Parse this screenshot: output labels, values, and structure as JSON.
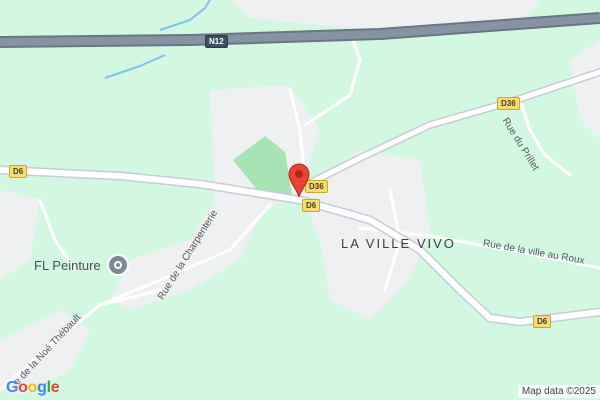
{
  "map": {
    "locality": "LA VILLE VIVO",
    "roads": {
      "charpenterie": "Rue de la Charpenterie",
      "noe_thebault": "e de la Noé Thébault",
      "ville_au_roux": "Rue de la ville au Roux",
      "prillet": "Rue du Prillet"
    },
    "shields": {
      "n12": "N12",
      "d6_left": "D6",
      "d6_center": "D6",
      "d6_right": "D6",
      "d36_top": "D36",
      "d36_center": "D36"
    },
    "poi": {
      "label": "FL Peinture",
      "icon": "pin-place-icon"
    },
    "marker": {
      "icon": "red-map-pin-icon",
      "color": "#ea4335"
    },
    "colors": {
      "land": "#d3f8e2",
      "settlement": "#eef0f2",
      "park": "#a8e3b3",
      "highway": "#7b8796",
      "road": "#ffffff",
      "water": "#7fc3e8"
    },
    "logo": "Google",
    "attribution": "Map data ©2025"
  }
}
